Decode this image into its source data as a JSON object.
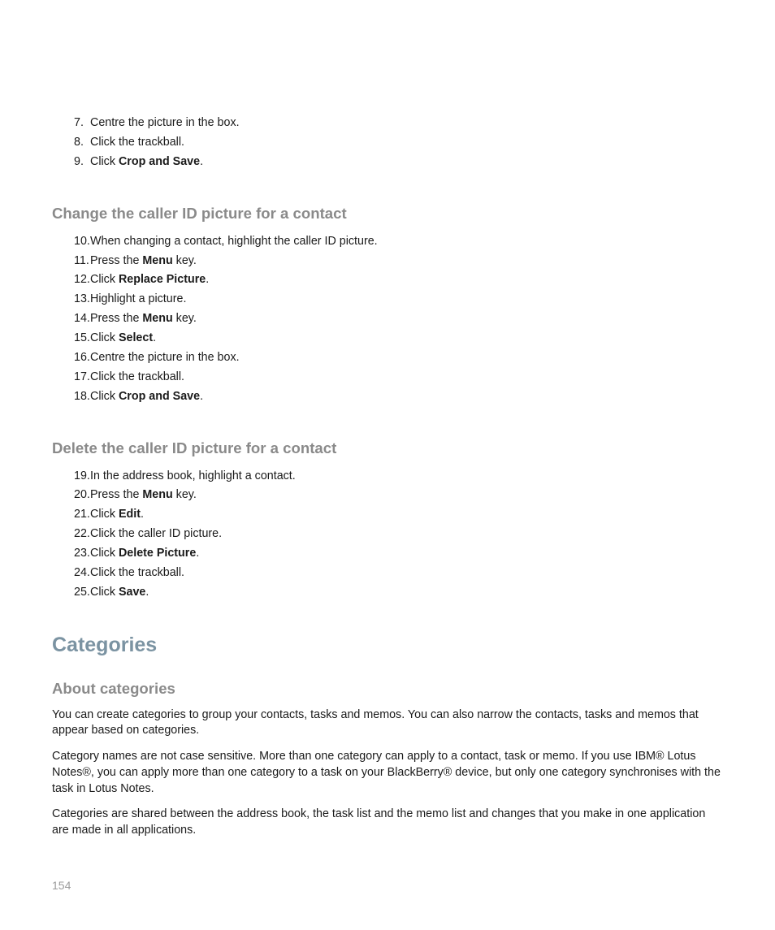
{
  "sec1_items": [
    {
      "pre": "Centre the picture in the box.",
      "bold": "",
      "post": ""
    },
    {
      "pre": "Click the trackball.",
      "bold": "",
      "post": ""
    },
    {
      "pre": "Click ",
      "bold": "Crop and Save",
      "post": "."
    }
  ],
  "h3_change": "Change the caller ID picture for a contact",
  "sec2_items": [
    {
      "pre": "When changing a contact, highlight the caller ID picture.",
      "bold": "",
      "post": ""
    },
    {
      "pre": "Press the ",
      "bold": "Menu",
      "post": " key."
    },
    {
      "pre": "Click ",
      "bold": "Replace Picture",
      "post": "."
    },
    {
      "pre": "Highlight a picture.",
      "bold": "",
      "post": ""
    },
    {
      "pre": "Press the ",
      "bold": "Menu",
      "post": " key."
    },
    {
      "pre": "Click ",
      "bold": "Select",
      "post": "."
    },
    {
      "pre": "Centre the picture in the box.",
      "bold": "",
      "post": ""
    },
    {
      "pre": "Click the trackball.",
      "bold": "",
      "post": ""
    },
    {
      "pre": "Click ",
      "bold": "Crop and Save",
      "post": "."
    }
  ],
  "h3_delete": "Delete the caller ID picture for a contact",
  "sec3_items": [
    {
      "pre": "In the address book, highlight a contact.",
      "bold": "",
      "post": ""
    },
    {
      "pre": "Press the ",
      "bold": "Menu",
      "post": " key."
    },
    {
      "pre": "Click ",
      "bold": "Edit",
      "post": "."
    },
    {
      "pre": "Click the caller ID picture.",
      "bold": "",
      "post": ""
    },
    {
      "pre": "Click ",
      "bold": "Delete Picture",
      "post": "."
    },
    {
      "pre": "Click the trackball.",
      "bold": "",
      "post": ""
    },
    {
      "pre": "Click ",
      "bold": "Save",
      "post": "."
    }
  ],
  "h2_categories": "Categories",
  "h3_about": "About categories",
  "para1": "You can create categories to group your contacts, tasks and memos. You can also narrow the contacts, tasks and memos that appear based on categories.",
  "para2": "Category names are not case sensitive. More than one category can apply to a contact, task or memo. If you use IBM® Lotus Notes®, you can apply more than one category to a task on your BlackBerry® device, but only one category synchronises with the task in Lotus Notes.",
  "para3": "Categories are shared between the address book, the task list and the memo list and changes that you make in one application are made in all applications.",
  "page_number": "154"
}
